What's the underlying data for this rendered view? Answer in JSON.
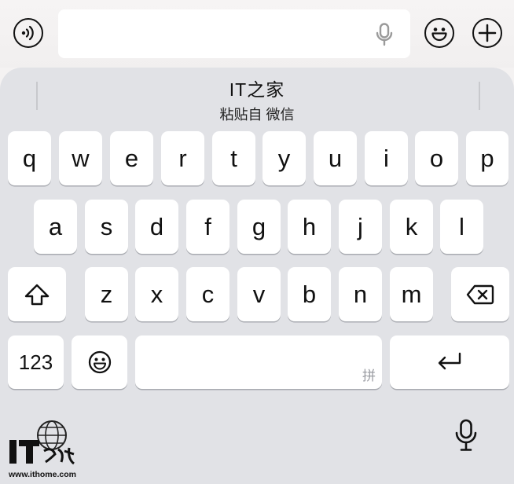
{
  "input_bar": {
    "left_icon": "voice-toggle-icon",
    "text_value": "",
    "mic_icon": "microphone-icon",
    "emoji_icon": "emoji-icon",
    "plus_icon": "plus-icon"
  },
  "candidate_bar": {
    "suggestion": "IT之家",
    "source_label": "粘贴自 微信"
  },
  "keyboard": {
    "row1": [
      "q",
      "w",
      "e",
      "r",
      "t",
      "y",
      "u",
      "i",
      "o",
      "p"
    ],
    "row2": [
      "a",
      "s",
      "d",
      "f",
      "g",
      "h",
      "j",
      "k",
      "l"
    ],
    "row3": [
      "z",
      "x",
      "c",
      "v",
      "b",
      "n",
      "m"
    ],
    "shift_icon": "shift-icon",
    "delete_icon": "delete-icon",
    "numbers_label": "123",
    "emoji_key_icon": "emoji-icon",
    "space_hint": "拼",
    "return_icon": "return-icon",
    "dictation_icon": "microphone-icon"
  },
  "watermark": {
    "logo": "IT之家",
    "url": "www.ithome.com"
  }
}
